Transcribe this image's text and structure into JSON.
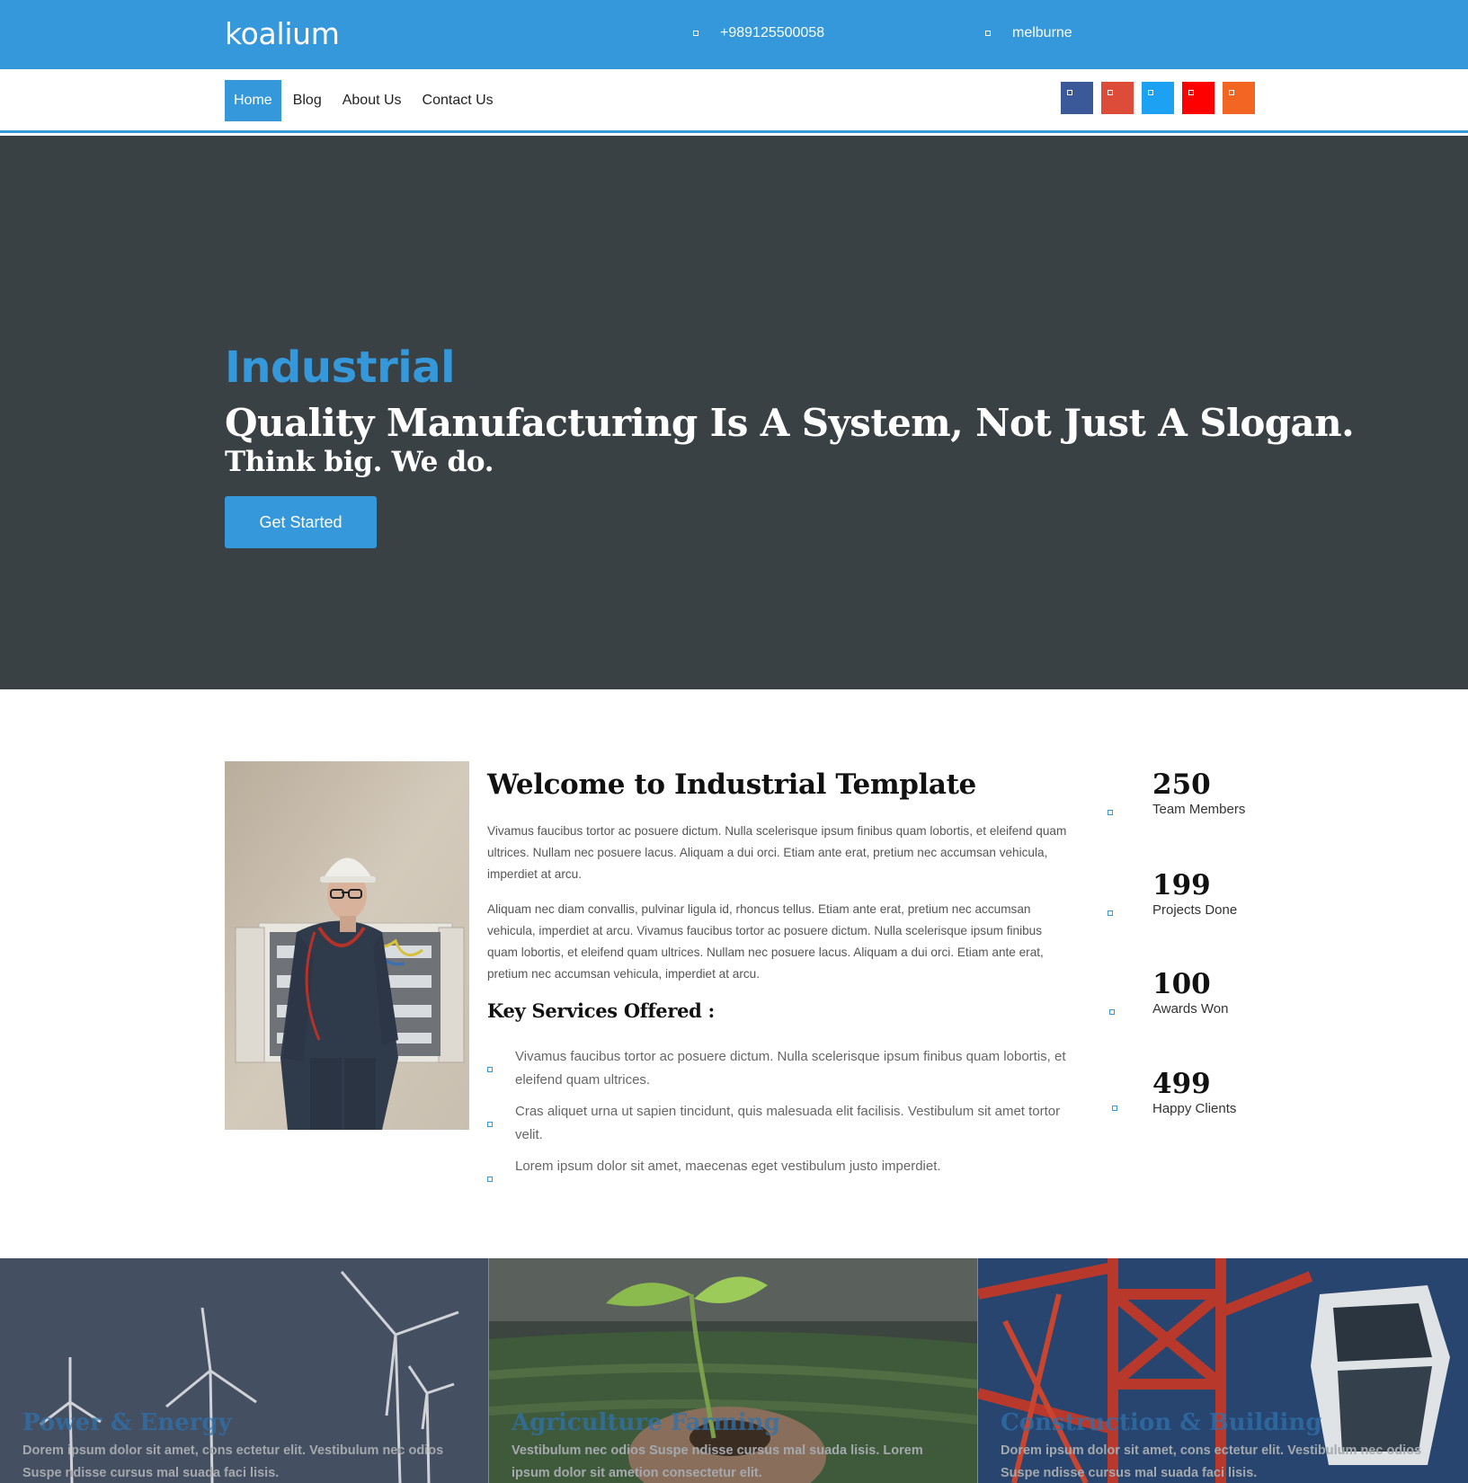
{
  "header": {
    "logo": "koalium",
    "phone": "+989125500058",
    "location": "melburne",
    "phone_icon": "phone-icon",
    "location_icon": "map-marker-icon"
  },
  "nav": {
    "items": [
      "Home",
      "Blog",
      "About Us",
      "Contact Us"
    ],
    "active": "Home"
  },
  "socials": [
    {
      "name": "facebook-icon",
      "color": "#3b5998"
    },
    {
      "name": "google-plus-icon",
      "color": "#dd4b39"
    },
    {
      "name": "twitter-icon",
      "color": "#1da1f2"
    },
    {
      "name": "youtube-icon",
      "color": "#ff0000"
    },
    {
      "name": "rss-icon",
      "color": "#f26522"
    }
  ],
  "hero": {
    "kicker": "Industrial",
    "headline": "Quality Manufacturing Is A System, Not Just A Slogan.",
    "subheadline": "Think big. We do.",
    "cta": "Get Started"
  },
  "about": {
    "title": "Welcome to Industrial Template",
    "paragraph1": "Vivamus faucibus tortor ac posuere dictum. Nulla scelerisque ipsum finibus quam lobortis, et eleifend quam ultrices. Nullam nec posuere lacus. Aliquam a dui orci. Etiam ante erat, pretium nec accumsan vehicula, imperdiet at arcu.",
    "paragraph2": "Aliquam nec diam convallis, pulvinar ligula id, rhoncus tellus. Etiam ante erat, pretium nec accumsan vehicula, imperdiet at arcu. Vivamus faucibus tortor ac posuere dictum. Nulla scelerisque ipsum finibus quam lobortis, et eleifend quam ultrices. Nullam nec posuere lacus. Aliquam a dui orci. Etiam ante erat, pretium nec accumsan vehicula, imperdiet at arcu.",
    "services_title": "Key Services Offered :",
    "services": [
      "Vivamus faucibus tortor ac posuere dictum. Nulla scelerisque ipsum finibus quam lobortis, et eleifend quam ultrices.",
      "Cras aliquet urna ut sapien tincidunt, quis malesuada elit facilisis. Vestibulum sit amet tortor velit.",
      "Lorem ipsum dolor sit amet, maecenas eget vestibulum justo imperdiet."
    ]
  },
  "stats": [
    {
      "value": "250",
      "label": "Team Members"
    },
    {
      "value": "199",
      "label": "Projects Done"
    },
    {
      "value": "100",
      "label": "Awards Won"
    },
    {
      "value": "499",
      "label": "Happy Clients"
    }
  ],
  "cards": [
    {
      "title": "Power & Energy",
      "desc": "Dorem ipsum dolor sit amet, cons ectetur elit. Vestibulum nec odios Suspe ndisse cursus mal suada faci lisis."
    },
    {
      "title": "Agriculture Farming",
      "desc": "Vestibulum nec odios Suspe ndisse cursus mal suada lisis. Lorem ipsum dolor sit ametion consectetur elit."
    },
    {
      "title": "Construction & Building",
      "desc": "Dorem ipsum dolor sit amet, cons ectetur elit. Vestibulum nec odios Suspe ndisse cursus mal suada faci lisis."
    }
  ]
}
